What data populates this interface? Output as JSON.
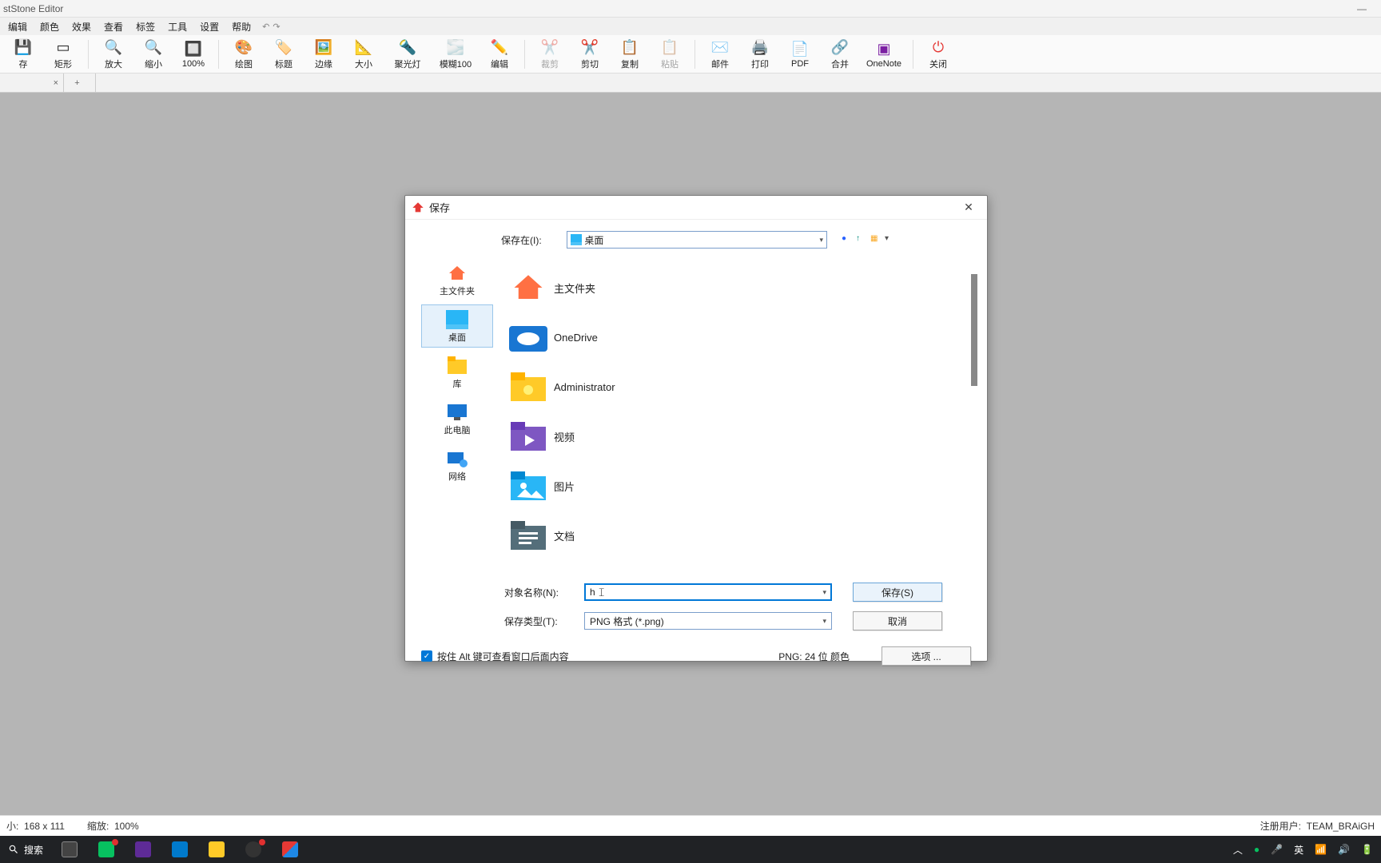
{
  "app": {
    "title": "stStone Editor"
  },
  "menu": {
    "items": [
      "编辑",
      "颜色",
      "效果",
      "查看",
      "标签",
      "工具",
      "设置",
      "帮助"
    ]
  },
  "toolbar": {
    "save": "存",
    "rect": "矩形",
    "zoomIn": "放大",
    "zoomOut": "缩小",
    "zoom100": "100%",
    "draw": "绘图",
    "caption": "标题",
    "edge": "边缘",
    "resize": "大小",
    "spotlight": "聚光灯",
    "blur": "模糊100",
    "edit": "编辑",
    "crop": "裁剪",
    "cut": "剪切",
    "copy": "复制",
    "paste": "粘贴",
    "mail": "邮件",
    "print": "打印",
    "pdf": "PDF",
    "merge": "合并",
    "onenote": "OneNote",
    "close": "关闭"
  },
  "status": {
    "sizeLabel": "小:",
    "sizeValue": "168 x 111",
    "zoomLabel": "缩放:",
    "zoomValue": "100%",
    "userLabel": "注册用户:",
    "userValue": "TEAM_BRAiGH"
  },
  "taskbar": {
    "search": "搜索",
    "ime": "英",
    "time": ""
  },
  "dialog": {
    "title": "保存",
    "saveInLabel": "保存在(I):",
    "location": "桌面",
    "places": {
      "home": "主文件夹",
      "desktop": "桌面",
      "library": "库",
      "thispc": "此电脑",
      "network": "网络"
    },
    "files": [
      {
        "name": "主文件夹",
        "icon": "home"
      },
      {
        "name": "OneDrive",
        "icon": "onedrive"
      },
      {
        "name": "Administrator",
        "icon": "user-folder"
      },
      {
        "name": "视频",
        "icon": "video"
      },
      {
        "name": "图片",
        "icon": "pictures"
      },
      {
        "name": "文档",
        "icon": "documents"
      }
    ],
    "nameLabel": "对象名称(N):",
    "nameValue": "h",
    "typeLabel": "保存类型(T):",
    "typeValue": "PNG 格式 (*.png)",
    "saveBtn": "保存(S)",
    "cancelBtn": "取消",
    "altHint": "按住 Alt 键可查看窗口后面内容",
    "formatInfo": "PNG: 24 位 颜色",
    "optionsBtn": "选项 ..."
  }
}
